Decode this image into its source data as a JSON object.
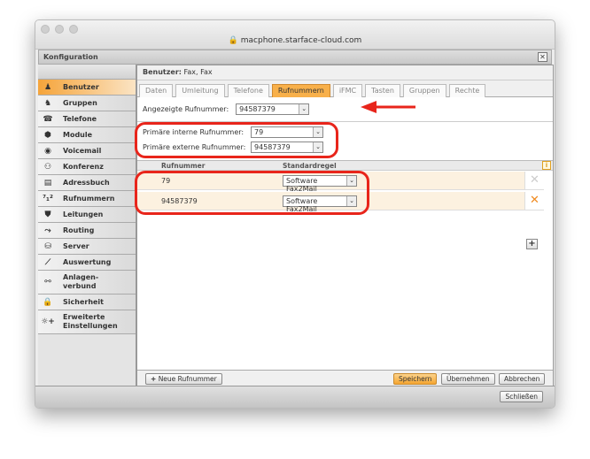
{
  "browser": {
    "url": "macphone.starface-cloud.com"
  },
  "window": {
    "title": "Konfiguration"
  },
  "sidebar": {
    "items": [
      {
        "label": "Benutzer",
        "icon": "user-icon",
        "glyph": "♟"
      },
      {
        "label": "Gruppen",
        "icon": "group-icon",
        "glyph": "♞"
      },
      {
        "label": "Telefone",
        "icon": "phone-icon",
        "glyph": "☎"
      },
      {
        "label": "Module",
        "icon": "module-icon",
        "glyph": "⬢"
      },
      {
        "label": "Voicemail",
        "icon": "voicemail-icon",
        "glyph": "◉"
      },
      {
        "label": "Konferenz",
        "icon": "conference-icon",
        "glyph": "⚇"
      },
      {
        "label": "Adressbuch",
        "icon": "addressbook-icon",
        "glyph": "▤"
      },
      {
        "label": "Rufnummern",
        "icon": "numbers-icon",
        "glyph": "⁷₁²"
      },
      {
        "label": "Leitungen",
        "icon": "lines-icon",
        "glyph": "⛊"
      },
      {
        "label": "Routing",
        "icon": "routing-icon",
        "glyph": "⤳"
      },
      {
        "label": "Server",
        "icon": "server-icon",
        "glyph": "⛁"
      },
      {
        "label": "Auswertung",
        "icon": "chart-icon",
        "glyph": "⟋"
      },
      {
        "label": "Anlagen-\nverbund",
        "icon": "network-icon",
        "glyph": "⚯"
      },
      {
        "label": "Sicherheit",
        "icon": "lock-icon",
        "glyph": "🔒"
      },
      {
        "label": "Erweiterte\nEinstellungen",
        "icon": "settings-plus-icon",
        "glyph": "☼+"
      }
    ]
  },
  "main": {
    "header_label": "Benutzer:",
    "header_value": "Fax, Fax",
    "tabs": [
      "Daten",
      "Umleitung",
      "Telefone",
      "Rufnummern",
      "iFMC",
      "Tasten",
      "Gruppen",
      "Rechte"
    ],
    "active_tab": "Rufnummern",
    "displayed_label": "Angezeigte Rufnummer:",
    "displayed_value": "94587379",
    "internal_label": "Primäre interne Rufnummer:",
    "internal_value": "79",
    "external_label": "Primäre externe Rufnummer:",
    "external_value": "94587379",
    "col_number": "Rufnummer",
    "col_rule": "Standardregel",
    "rows": [
      {
        "number": "79",
        "rule": "Software Fax2Mail"
      },
      {
        "number": "94587379",
        "rule": "Software Fax2Mail"
      }
    ],
    "new_number": "Neue Rufnummer",
    "save": "Speichern",
    "apply": "Übernehmen",
    "cancel": "Abbrechen"
  },
  "footer": {
    "close": "Schließen"
  },
  "colors": {
    "accent": "#f5a530",
    "annotation": "#e8251b"
  }
}
